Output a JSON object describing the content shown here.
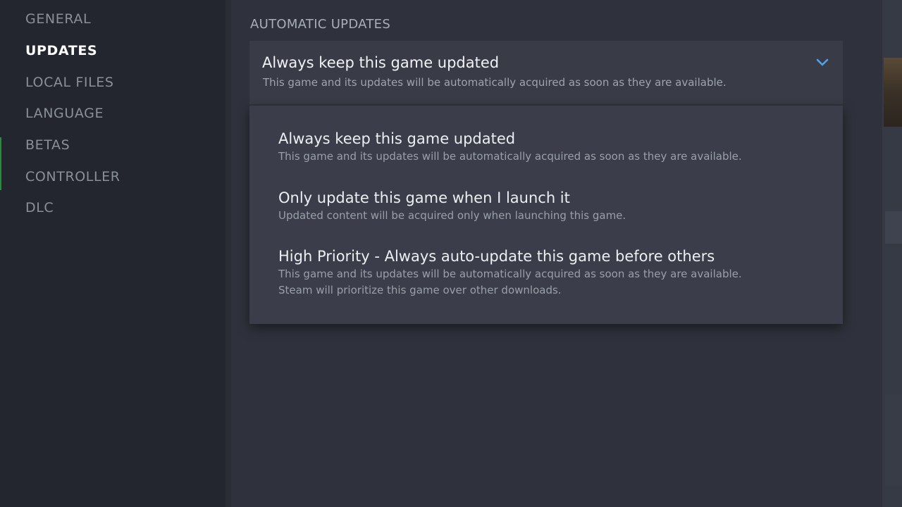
{
  "sidebar": {
    "items": [
      {
        "label": "GENERAL",
        "active": false
      },
      {
        "label": "UPDATES",
        "active": true
      },
      {
        "label": "LOCAL FILES",
        "active": false
      },
      {
        "label": "LANGUAGE",
        "active": false
      },
      {
        "label": "BETAS",
        "active": false
      },
      {
        "label": "CONTROLLER",
        "active": false
      },
      {
        "label": "DLC",
        "active": false
      }
    ]
  },
  "main": {
    "section_heading": "AUTOMATIC UPDATES",
    "select": {
      "title": "Always keep this game updated",
      "description": "This game and its updates will be automatically acquired as soon as they are available.",
      "icon": "chevron-down-icon"
    },
    "options": [
      {
        "title": "Always keep this game updated",
        "description": "This game and its updates will be automatically acquired as soon as they are available."
      },
      {
        "title": "Only update this game when I launch it",
        "description": "Updated content will be acquired only when launching this game."
      },
      {
        "title": "High Priority - Always auto-update this game before others",
        "description": "This game and its updates will be automatically acquired as soon as they are available.",
        "description2": "Steam will prioritize this game over other downloads."
      }
    ]
  },
  "colors": {
    "accent_blue": "#4fa3e8",
    "active_text": "#ffffff",
    "inactive_text": "#8a8f98"
  }
}
